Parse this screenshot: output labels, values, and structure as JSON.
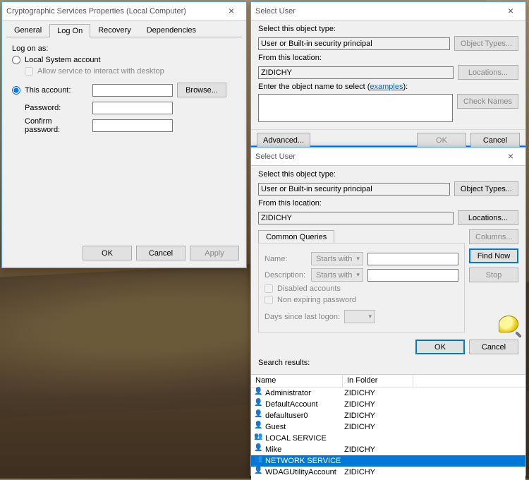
{
  "win1": {
    "title": "Cryptographic Services Properties (Local Computer)",
    "tabs": {
      "general": "General",
      "logon": "Log On",
      "recovery": "Recovery",
      "dependencies": "Dependencies"
    },
    "logon_as": "Log on as:",
    "radio_local": "Local System account",
    "chk_interact": "Allow service to interact with desktop",
    "radio_this": "This account:",
    "this_account_value": "",
    "browse": "Browse...",
    "password_label": "Password:",
    "password_value": "•••••••••••••••",
    "confirm_label": "Confirm password:",
    "confirm_value": "•••••••••••••••",
    "ok": "OK",
    "cancel": "Cancel",
    "apply": "Apply"
  },
  "win2": {
    "title": "Select User",
    "sel_obj": "Select this object type:",
    "obj_val": "User or Built-in security principal",
    "obj_types": "Object Types...",
    "from_loc": "From this location:",
    "loc_val": "ZIDICHY",
    "locations": "Locations...",
    "enter_name": "Enter the object name to select (",
    "enter_name2": "):",
    "examples": "examples",
    "check_names": "Check Names",
    "advanced": "Advanced...",
    "ok": "OK",
    "cancel": "Cancel"
  },
  "win3": {
    "title": "Select User",
    "sel_obj": "Select this object type:",
    "obj_val": "User or Built-in security principal",
    "obj_types": "Object Types...",
    "from_loc": "From this location:",
    "loc_val": "ZIDICHY",
    "locations": "Locations...",
    "common_q": "Common Queries",
    "name_lbl": "Name:",
    "desc_lbl": "Description:",
    "starts_with": "Starts with",
    "disabled_acc": "Disabled accounts",
    "non_exp": "Non expiring password",
    "days_since": "Days since last logon:",
    "columns": "Columns...",
    "find_now": "Find Now",
    "stop": "Stop",
    "ok": "OK",
    "cancel": "Cancel",
    "search_results": "Search results:",
    "col_name": "Name",
    "col_folder": "In Folder",
    "rows": [
      {
        "name": "Administrator",
        "folder": "ZIDICHY",
        "type": "user"
      },
      {
        "name": "DefaultAccount",
        "folder": "ZIDICHY",
        "type": "user"
      },
      {
        "name": "defaultuser0",
        "folder": "ZIDICHY",
        "type": "user"
      },
      {
        "name": "Guest",
        "folder": "ZIDICHY",
        "type": "user"
      },
      {
        "name": "LOCAL SERVICE",
        "folder": "",
        "type": "group"
      },
      {
        "name": "Mike",
        "folder": "ZIDICHY",
        "type": "user"
      },
      {
        "name": "NETWORK SERVICE",
        "folder": "",
        "type": "group",
        "selected": true
      },
      {
        "name": "WDAGUtilityAccount",
        "folder": "ZIDICHY",
        "type": "user"
      }
    ]
  }
}
